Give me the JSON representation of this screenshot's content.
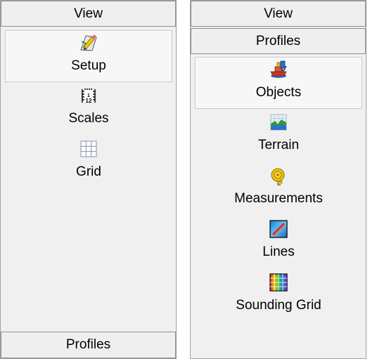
{
  "left_panel": {
    "view_label": "View",
    "profiles_label": "Profiles",
    "items": [
      {
        "label": "Setup",
        "icon": "setup-icon"
      },
      {
        "label": "Scales",
        "icon": "scales-icon"
      },
      {
        "label": "Grid",
        "icon": "grid-icon"
      }
    ]
  },
  "right_panel": {
    "view_label": "View",
    "profiles_label": "Profiles",
    "items": [
      {
        "label": "Objects",
        "icon": "objects-icon"
      },
      {
        "label": "Terrain",
        "icon": "terrain-icon"
      },
      {
        "label": "Measurements",
        "icon": "measurements-icon"
      },
      {
        "label": "Lines",
        "icon": "lines-icon"
      },
      {
        "label": "Sounding Grid",
        "icon": "sounding-grid-icon"
      }
    ]
  }
}
